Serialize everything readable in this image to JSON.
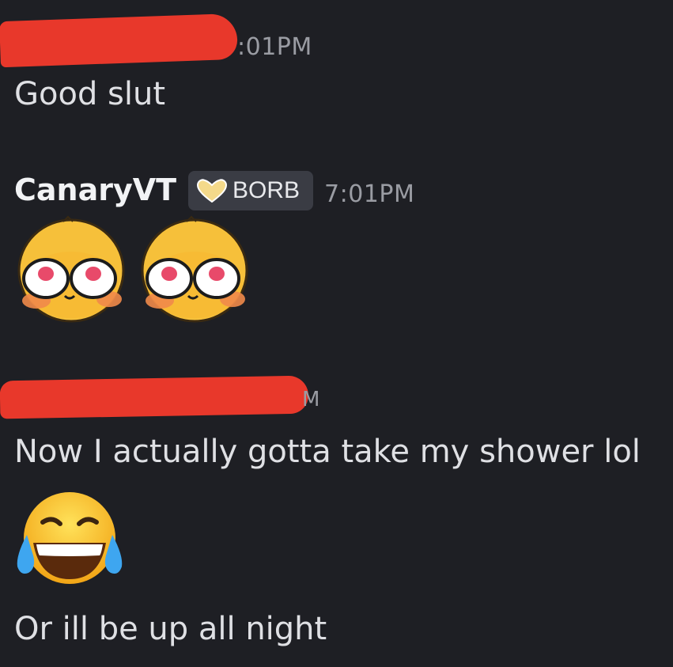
{
  "messages": [
    {
      "author": "",
      "time": ":01PM",
      "text": "Good slut"
    },
    {
      "author": "CanaryVT",
      "badge": "BORB",
      "time": "7:01PM",
      "stickers": [
        "blushing-emoji-sticker",
        "blushing-emoji-sticker"
      ]
    },
    {
      "author": "",
      "time": "M",
      "lines": [
        "Now I actually gotta take my shower lol",
        "Or ill be up all night"
      ],
      "emoji": "face-with-tears-of-joy-icon"
    }
  ],
  "colors": {
    "background": "#1e1f24",
    "redaction": "#e8382b",
    "timestamp": "#9a9ca3",
    "badge_bg": "#3a3c44",
    "heart": "#f4d98a"
  }
}
